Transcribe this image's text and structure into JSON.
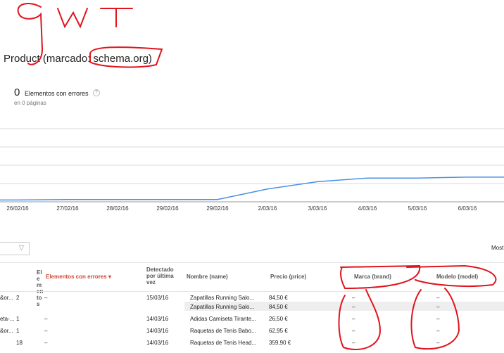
{
  "annotation_text": "GWT",
  "header": {
    "title": "Product (marcado: schema.org)",
    "error_count": "0",
    "error_count_label": "Elementos con errores",
    "help_icon": "?",
    "pages_label": "en 0 páginas"
  },
  "chart_data": {
    "type": "line",
    "x": [
      "26/02/16",
      "27/02/16",
      "28/02/16",
      "29/02/16",
      "29/02/16",
      "2/03/16",
      "3/03/16",
      "4/03/16",
      "5/03/16",
      "6/03/16"
    ],
    "series": [
      {
        "values": [
          2,
          2.5,
          2.5,
          2.5,
          2.5,
          14,
          22,
          26,
          26,
          27
        ]
      }
    ],
    "ylim": [
      0,
      100
    ],
    "grid": true,
    "color": "#4a90e2"
  },
  "filter": {
    "icon": "filter-icon"
  },
  "show_label": "Most",
  "table": {
    "headers": {
      "col0": "",
      "elementos": "Elementos",
      "errores": "Elementos con errores",
      "detectado": "Detectado por última vez",
      "nombre": "Nombre (name)",
      "precio": "Precio (price)",
      "marca": "Marca (brand)",
      "modelo": "Modelo (model)"
    },
    "rows": [
      {
        "col0": "&or...",
        "elementos": "2",
        "errores": "–",
        "detectado": "15/03/16",
        "nombre": "Zapatillas Running Salo...",
        "precio": "84,50 €",
        "marca": "–",
        "modelo": "–"
      },
      {
        "col0": "",
        "elementos": "",
        "errores": "",
        "detectado": "",
        "nombre": "Zapatillas Running Salo...",
        "precio": "84,50 €",
        "marca": "–",
        "modelo": "–"
      },
      {
        "col0": "eta-...",
        "elementos": "1",
        "errores": "–",
        "detectado": "14/03/16",
        "nombre": "Adidas Camiseta Tirante...",
        "precio": "26,50 €",
        "marca": "–",
        "modelo": "–"
      },
      {
        "col0": "&or...",
        "elementos": "1",
        "errores": "–",
        "detectado": "14/03/16",
        "nombre": "Raquetas de Tenis Babo...",
        "precio": "62,95 €",
        "marca": "–",
        "modelo": "–"
      },
      {
        "col0": "",
        "elementos": "18",
        "errores": "–",
        "detectado": "14/03/16",
        "nombre": "Raquetas de Tenis Head...",
        "precio": "359,90 €",
        "marca": "–",
        "modelo": "–"
      }
    ]
  },
  "colors": {
    "annotation": "#e0141e",
    "line": "#4a90e2",
    "error_header": "#d14836"
  }
}
